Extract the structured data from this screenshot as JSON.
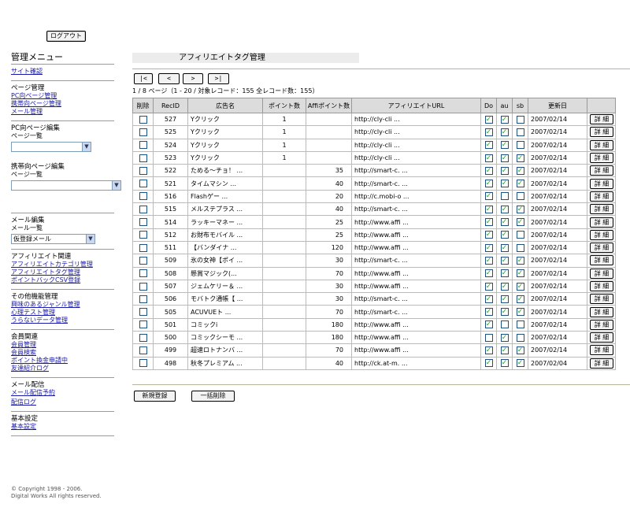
{
  "header": {
    "logout_label": "ログアウト"
  },
  "sidebar": {
    "title": "管理メニュー",
    "site_check": "サイト確認",
    "page_mgmt": {
      "heading": "ページ管理",
      "links": [
        "PC向ページ管理",
        "携帯向ページ管理",
        "メール管理"
      ]
    },
    "pc_edit": {
      "heading": "PC向ページ編集",
      "list_label": "ページ一覧",
      "select_value": ""
    },
    "mobile_edit": {
      "heading": "携帯向ページ編集",
      "list_label": "ページ一覧",
      "select_value": ""
    },
    "mail_edit": {
      "heading": "メール編集",
      "list_label": "メール一覧",
      "select_value": "仮登録メール"
    },
    "affiliate": {
      "heading": "アフィリエイト関連",
      "links": [
        "アフィリエイトカテゴリ管理",
        "アフィリエイトタグ管理",
        "ポイントバックCSV登録"
      ]
    },
    "other": {
      "heading": "その他機能管理",
      "links": [
        "興味のあるジャンル管理",
        "心理テスト管理",
        "うらないデータ管理"
      ]
    },
    "members": {
      "heading": "会員関連",
      "links": [
        "会員管理",
        "会員検索",
        "ポイント換金申請中",
        "友達紹介ログ"
      ]
    },
    "mail_delivery": {
      "heading": "メール配信",
      "links": [
        "メール配信予約",
        "配信ログ"
      ]
    },
    "basic": {
      "heading": "基本設定",
      "links": [
        "基本設定"
      ]
    }
  },
  "copyright": "© Copyright 1998 - 2006. Digital Works All rights reserved.",
  "main": {
    "title": "アフィリエイトタグ管理",
    "nav": {
      "first": "|<",
      "prev": "<",
      "next": ">",
      "last": ">|"
    },
    "page_info": "1 / 8 ページ（1 - 20 / 対象レコード：155 全レコード数：155）",
    "columns": [
      "削除",
      "RecID",
      "広告名",
      "ポイント数",
      "Affiポイント数",
      "アフィリエイトURL",
      "Do",
      "au",
      "sb",
      "更新日",
      ""
    ],
    "detail_label": "詳 細",
    "rows": [
      {
        "id": "527",
        "name": "Yクリック",
        "points": "1",
        "affi": "",
        "url": "http://cly-cli ...",
        "do": true,
        "au": true,
        "sb": false,
        "date": "2007/02/14"
      },
      {
        "id": "525",
        "name": "Yクリック",
        "points": "1",
        "affi": "",
        "url": "http://cly-cli ...",
        "do": true,
        "au": true,
        "sb": false,
        "date": "2007/02/14"
      },
      {
        "id": "524",
        "name": "Yクリック",
        "points": "1",
        "affi": "",
        "url": "http://cly-cli ...",
        "do": true,
        "au": true,
        "sb": false,
        "date": "2007/02/14"
      },
      {
        "id": "523",
        "name": "Yクリック",
        "points": "1",
        "affi": "",
        "url": "http://cly-cli ...",
        "do": true,
        "au": true,
        "sb": true,
        "date": "2007/02/14"
      },
      {
        "id": "522",
        "name": "ためる～チョ！ ...",
        "points": "",
        "affi": "35",
        "url": "http://smart-c. ...",
        "do": true,
        "au": true,
        "sb": true,
        "date": "2007/02/14"
      },
      {
        "id": "521",
        "name": "タイムマシン ...",
        "points": "",
        "affi": "40",
        "url": "http://smart-c. ...",
        "do": true,
        "au": true,
        "sb": true,
        "date": "2007/02/14"
      },
      {
        "id": "516",
        "name": "Flashゲー ...",
        "points": "",
        "affi": "20",
        "url": "http://c.mobi-o ...",
        "do": true,
        "au": false,
        "sb": false,
        "date": "2007/02/14"
      },
      {
        "id": "515",
        "name": "メルステプラス ...",
        "points": "",
        "affi": "40",
        "url": "http://smart-c. ...",
        "do": true,
        "au": true,
        "sb": true,
        "date": "2007/02/14"
      },
      {
        "id": "514",
        "name": "ラッキーマネー ...",
        "points": "",
        "affi": "25",
        "url": "http://www.affi ...",
        "do": true,
        "au": true,
        "sb": true,
        "date": "2007/02/14"
      },
      {
        "id": "512",
        "name": "お財布モバイル ...",
        "points": "",
        "affi": "25",
        "url": "http://www.affi ...",
        "do": true,
        "au": true,
        "sb": false,
        "date": "2007/02/14"
      },
      {
        "id": "511",
        "name": "【バンダイナ ...",
        "points": "",
        "affi": "120",
        "url": "http://www.affi ...",
        "do": true,
        "au": true,
        "sb": false,
        "date": "2007/02/14"
      },
      {
        "id": "509",
        "name": "氷の女神【ポイ ...",
        "points": "",
        "affi": "30",
        "url": "http://smart-c. ...",
        "do": true,
        "au": true,
        "sb": true,
        "date": "2007/02/14"
      },
      {
        "id": "508",
        "name": "懸賞マジック(...",
        "points": "",
        "affi": "70",
        "url": "http://www.affi ...",
        "do": true,
        "au": true,
        "sb": true,
        "date": "2007/02/14"
      },
      {
        "id": "507",
        "name": "ジェムケリー＆ ...",
        "points": "",
        "affi": "30",
        "url": "http://www.affi ...",
        "do": true,
        "au": true,
        "sb": true,
        "date": "2007/02/14"
      },
      {
        "id": "506",
        "name": "モバトク通帳【 ...",
        "points": "",
        "affi": "30",
        "url": "http://smart-c. ...",
        "do": true,
        "au": true,
        "sb": true,
        "date": "2007/02/14"
      },
      {
        "id": "505",
        "name": "ACUVUEト ...",
        "points": "",
        "affi": "70",
        "url": "http://smart-c. ...",
        "do": true,
        "au": true,
        "sb": true,
        "date": "2007/02/14"
      },
      {
        "id": "501",
        "name": "コミックi",
        "points": "",
        "affi": "180",
        "url": "http://www.affi ...",
        "do": true,
        "au": false,
        "sb": false,
        "date": "2007/02/14"
      },
      {
        "id": "500",
        "name": "コミックシーモ ...",
        "points": "",
        "affi": "180",
        "url": "http://www.affi ...",
        "do": false,
        "au": true,
        "sb": false,
        "date": "2007/02/14"
      },
      {
        "id": "499",
        "name": "超速ロトナンバ ...",
        "points": "",
        "affi": "70",
        "url": "http://www.affi ...",
        "do": true,
        "au": true,
        "sb": true,
        "date": "2007/02/14"
      },
      {
        "id": "498",
        "name": "秋冬プレミアム ...",
        "points": "",
        "affi": "40",
        "url": "http://ck.at-m. ...",
        "do": true,
        "au": true,
        "sb": true,
        "date": "2007/02/04"
      }
    ],
    "new_button": "新規登録",
    "bulk_delete_button": "一括削除"
  }
}
